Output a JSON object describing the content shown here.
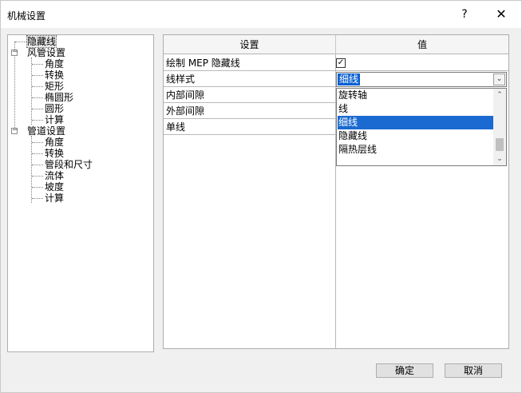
{
  "window": {
    "title": "机械设置",
    "help_label": "?",
    "close_label": "✕"
  },
  "tree": {
    "items": [
      {
        "label": "隐藏线",
        "level": 0,
        "expander": ""
      },
      {
        "label": "风管设置",
        "level": 0,
        "expander": "−"
      },
      {
        "label": "角度",
        "level": 1
      },
      {
        "label": "转换",
        "level": 1
      },
      {
        "label": "矩形",
        "level": 1
      },
      {
        "label": "椭圆形",
        "level": 1
      },
      {
        "label": "圆形",
        "level": 1
      },
      {
        "label": "计算",
        "level": 1
      },
      {
        "label": "管道设置",
        "level": 0,
        "expander": "−"
      },
      {
        "label": "角度",
        "level": 1
      },
      {
        "label": "转换",
        "level": 1
      },
      {
        "label": "管段和尺寸",
        "level": 1
      },
      {
        "label": "流体",
        "level": 1
      },
      {
        "label": "坡度",
        "level": 1
      },
      {
        "label": "计算",
        "level": 1
      }
    ]
  },
  "grid": {
    "headers": [
      "设置",
      "值"
    ],
    "rows": [
      {
        "setting": "绘制 MEP 隐藏线"
      },
      {
        "setting": "线样式"
      },
      {
        "setting": "内部间隙"
      },
      {
        "setting": "外部间隙"
      },
      {
        "setting": "单线"
      }
    ],
    "checkbox_mark": "✓",
    "combo_value": "细线",
    "combo_arrow": "⌄",
    "dropdown_options": [
      "旋转轴",
      "线",
      "细线",
      "隐藏线",
      "隔热层线"
    ],
    "scroll_up": "⌃",
    "scroll_down": "⌄"
  },
  "buttons": {
    "ok": "确定",
    "cancel": "取消"
  }
}
